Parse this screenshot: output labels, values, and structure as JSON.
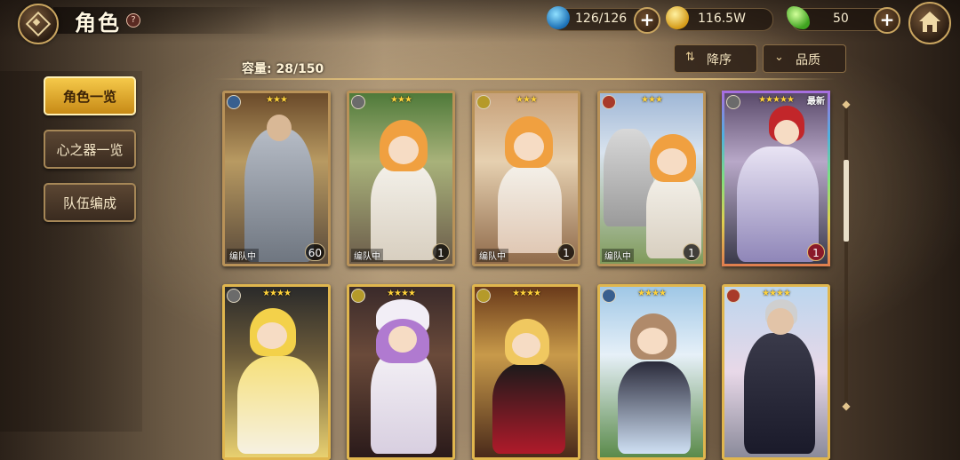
{
  "header": {
    "title": "角色",
    "help": "?"
  },
  "resources": {
    "stamina": "126/126",
    "gold": "116.5W",
    "gems": "50"
  },
  "capacity": "容量: 28/150",
  "sort": {
    "order_label": "降序",
    "filter_label": "品质"
  },
  "sidebar": {
    "items": [
      {
        "label": "角色一览"
      },
      {
        "label": "心之器一览"
      },
      {
        "label": "队伍编成"
      }
    ]
  },
  "cards": [
    {
      "stars": "★★★",
      "tag": "编队中",
      "level": "60",
      "new": ""
    },
    {
      "stars": "★★★",
      "tag": "编队中",
      "level": "1",
      "new": ""
    },
    {
      "stars": "★★★",
      "tag": "编队中",
      "level": "1",
      "new": ""
    },
    {
      "stars": "★★★",
      "tag": "编队中",
      "level": "1",
      "new": ""
    },
    {
      "stars": "★★★★★",
      "tag": "",
      "level": "1",
      "new": "最新"
    },
    {
      "stars": "★★★★",
      "tag": "",
      "level": "",
      "new": ""
    },
    {
      "stars": "★★★★",
      "tag": "",
      "level": "",
      "new": ""
    },
    {
      "stars": "★★★★",
      "tag": "",
      "level": "",
      "new": ""
    },
    {
      "stars": "★★★★",
      "tag": "",
      "level": "",
      "new": ""
    },
    {
      "stars": "★★★★",
      "tag": "",
      "level": "",
      "new": ""
    }
  ],
  "colors": {
    "accent_gold": "#e0b64e",
    "active_tab": "#f5c94a"
  }
}
